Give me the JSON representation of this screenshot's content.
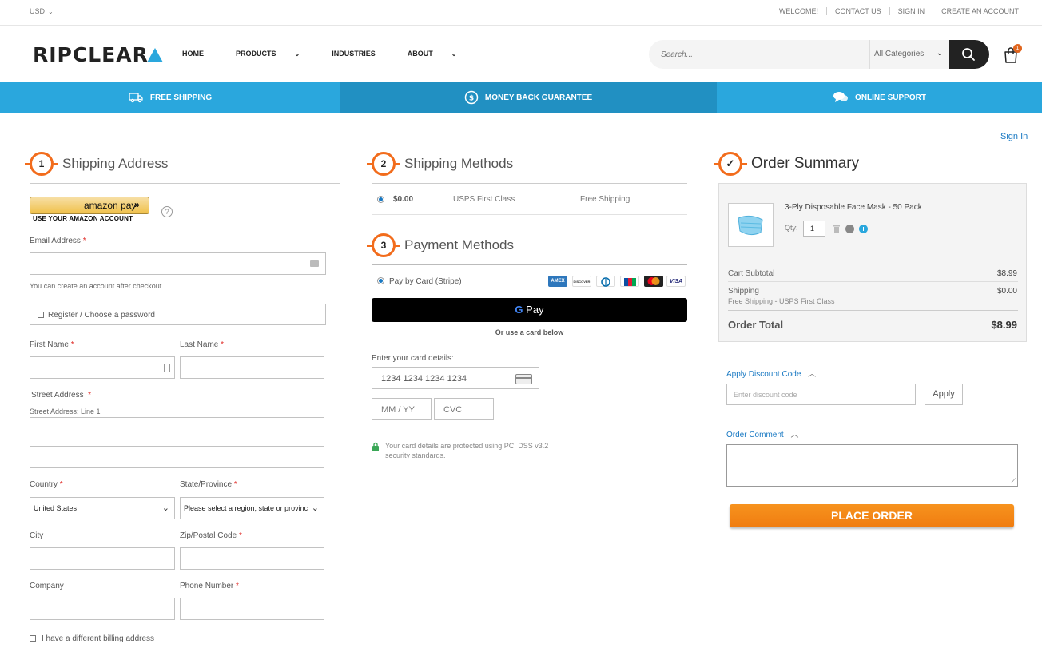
{
  "topbar": {
    "currency": "USD",
    "links": [
      "WELCOME!",
      "CONTACT US",
      "SIGN IN",
      "CREATE AN ACCOUNT"
    ]
  },
  "header": {
    "logo": "RIPCLEAR",
    "nav": [
      {
        "label": "HOME",
        "has_menu": false
      },
      {
        "label": "PRODUCTS",
        "has_menu": true
      },
      {
        "label": "INDUSTRIES",
        "has_menu": false
      },
      {
        "label": "ABOUT",
        "has_menu": true
      }
    ],
    "search_placeholder": "Search...",
    "search_category": "All Categories",
    "cart_count": "1"
  },
  "promo": {
    "items": [
      {
        "label": "FREE SHIPPING",
        "icon": "truck-icon"
      },
      {
        "label": "MONEY BACK GUARANTEE",
        "icon": "dollar-coin-icon"
      },
      {
        "label": "ONLINE SUPPORT",
        "icon": "chat-icon"
      }
    ]
  },
  "sign_in_link": "Sign In",
  "shipping_address": {
    "step": "1",
    "title": "Shipping Address",
    "amazon_pay_label": "amazon pay",
    "amazon_pay_sub": "USE YOUR AMAZON ACCOUNT",
    "help": "?",
    "email_label": "Email Address",
    "email_hint": "You can create an account after checkout.",
    "register_label": "Register / Choose a password",
    "first_name_label": "First Name",
    "last_name_label": "Last Name",
    "street_label": "Street Address",
    "street_line1_label": "Street Address: Line 1",
    "country_label": "Country",
    "country_value": "United States",
    "state_label": "State/Province",
    "state_value": "Please select a region, state or province.",
    "city_label": "City",
    "zip_label": "Zip/Postal Code",
    "company_label": "Company",
    "phone_label": "Phone Number",
    "billing_label": "I have a different billing address",
    "required_mark": "*"
  },
  "shipping_methods": {
    "step": "2",
    "title": "Shipping Methods",
    "price": "$0.00",
    "method": "USPS First Class",
    "carrier": "Free Shipping"
  },
  "payment_methods": {
    "step": "3",
    "title": "Payment Methods",
    "option": "Pay by Card (Stripe)",
    "card_logos": [
      "AMEX",
      "DISCOVER",
      "DINERS",
      "JCB",
      "MASTERCARD",
      "VISA"
    ],
    "gpay_label": "Pay",
    "gpay_g": "G",
    "alt_text": "Or use a card below",
    "card_details_label": "Enter your card details:",
    "card_number_placeholder": "1234 1234 1234 1234",
    "expiry_placeholder": "MM / YY",
    "cvc_placeholder": "CVC",
    "security_note_line1": "Your card details are protected using PCI DSS v3.2",
    "security_note_line2": "security standards."
  },
  "order_summary": {
    "step": "✓",
    "title": "Order Summary",
    "product_name": "3-Ply Disposable Face Mask - 50 Pack",
    "qty_label": "Qty:",
    "qty_value": "1",
    "subtotal_label": "Cart Subtotal",
    "subtotal_value": "$8.99",
    "shipping_label": "Shipping",
    "shipping_value": "$0.00",
    "shipping_detail": "Free Shipping - USPS First Class",
    "total_label": "Order Total",
    "total_value": "$8.99",
    "discount_label": "Apply Discount Code",
    "discount_placeholder": "Enter discount code",
    "apply_label": "Apply",
    "comment_label": "Order Comment",
    "place_order_label": "PLACE ORDER"
  },
  "colors": {
    "accent_blue": "#2aa7dd",
    "accent_blue_dark": "#2190c2",
    "step_orange": "#f26c1c",
    "place_order_orange": "#f7931e",
    "link_blue": "#1979c3"
  }
}
